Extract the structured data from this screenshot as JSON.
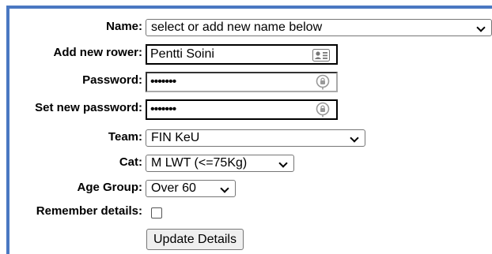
{
  "form": {
    "name": {
      "label": "Name:",
      "value": "select or add new name below",
      "icon": "chevron-down-icon"
    },
    "add_rower": {
      "label": "Add new rower:",
      "value": "Pentti Soini",
      "icon": "contact-card-icon"
    },
    "password": {
      "label": "Password:",
      "value": "•••••••",
      "icon": "key-lock-icon"
    },
    "set_password": {
      "label": "Set new password:",
      "value": "•••••••",
      "icon": "key-lock-icon"
    },
    "team": {
      "label": "Team:",
      "value": "FIN KeU",
      "icon": "chevron-down-icon"
    },
    "cat": {
      "label": "Cat:",
      "value": "M LWT (<=75Kg)",
      "icon": "chevron-down-icon"
    },
    "age_group": {
      "label": "Age Group:",
      "value": "Over 60",
      "icon": "chevron-down-icon"
    },
    "remember": {
      "label": "Remember details:",
      "checked": false
    },
    "update_button": {
      "label": "Update Details"
    }
  },
  "colors": {
    "accent_border": "#4a78c2"
  }
}
